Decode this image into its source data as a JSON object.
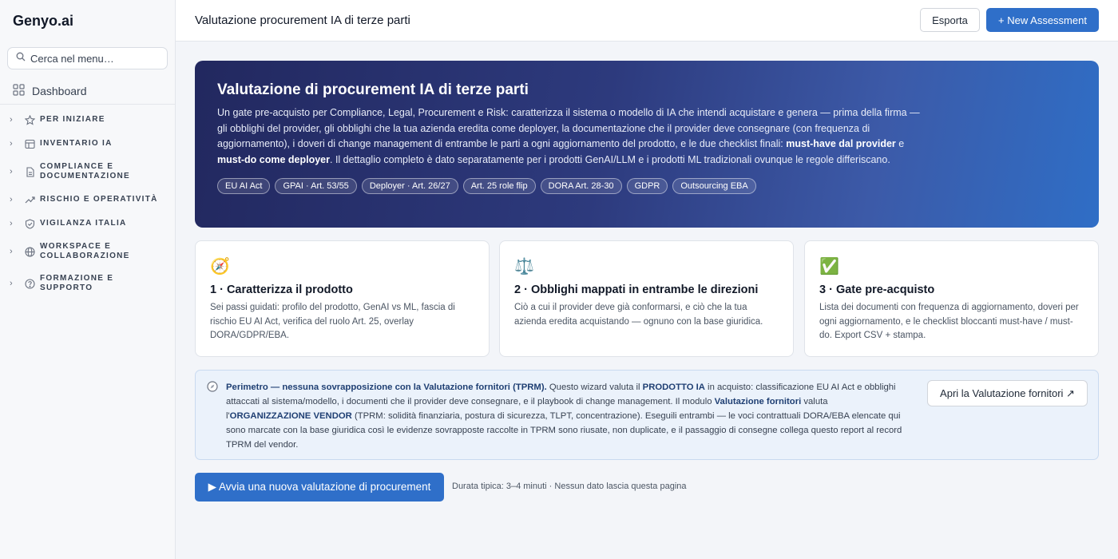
{
  "sidebar": {
    "brand": "Genyo.ai",
    "search_placeholder": "Cerca nel menu…",
    "dashboard_label": "Dashboard",
    "sections": [
      {
        "label": "PER INIZIARE",
        "icon": "star-icon"
      },
      {
        "label": "INVENTARIO IA",
        "icon": "table-icon"
      },
      {
        "label": "COMPLIANCE E DOCUMENTAZIONE",
        "icon": "document-icon"
      },
      {
        "label": "RISCHIO E OPERATIVITÀ",
        "icon": "trend-icon"
      },
      {
        "label": "VIGILANZA ITALIA",
        "icon": "shield-icon"
      },
      {
        "label": "WORKSPACE E COLLABORAZIONE",
        "icon": "globe-icon"
      },
      {
        "label": "FORMAZIONE E SUPPORTO",
        "icon": "help-icon"
      }
    ]
  },
  "header": {
    "title": "Valutazione procurement IA di terze parti",
    "export_label": "Esporta",
    "new_assessment_label": "+ New Assessment"
  },
  "hero": {
    "title": "Valutazione di procurement IA di terze parti",
    "desc_1": "Un gate pre-acquisto per Compliance, Legal, Procurement e Risk: caratterizza il sistema o modello di IA che intendi acquistare e genera — prima della firma — gli obblighi del provider, gli obblighi che la tua azienda eredita come deployer, la documentazione che il provider deve consegnare (con frequenza di aggiornamento), i doveri di change management di entrambe le parti a ogni aggiornamento del prodotto, e le due checklist finali: ",
    "desc_bold_1": "must-have dal provider",
    "desc_2": " e ",
    "desc_bold_2": "must-do come deployer",
    "desc_3": ". Il dettaglio completo è dato separatamente per i prodotti GenAI/LLM e i prodotti ML tradizionali ovunque le regole differiscano.",
    "tags": [
      "EU AI Act",
      "GPAI · Art. 53/55",
      "Deployer · Art. 26/27",
      "Art. 25 role flip",
      "DORA Art. 28-30",
      "GDPR",
      "Outsourcing EBA"
    ]
  },
  "cards": [
    {
      "icon": "compass-icon",
      "glyph": "🧭",
      "title": "1 · Caratterizza il prodotto",
      "desc": "Sei passi guidati: profilo del prodotto, GenAI vs ML, fascia di rischio EU AI Act, verifica del ruolo Art. 25, overlay DORA/GDPR/EBA."
    },
    {
      "icon": "scales-icon",
      "glyph": "⚖️",
      "title": "2 · Obblighi mappati in entrambe le direzioni",
      "desc": "Ciò a cui il provider deve già conformarsi, e ciò che la tua azienda eredita acquistando — ognuno con la base giuridica."
    },
    {
      "icon": "check-icon",
      "glyph": "✅",
      "title": "3 · Gate pre-acquisto",
      "desc": "Lista dei documenti con frequenza di aggiornamento, doveri per ogni aggiornamento, e le checklist bloccanti must-have / must-do. Export CSV + stampa."
    }
  ],
  "info": {
    "b1": "Perimetro — nessuna sovrapposizione con la Valutazione fornitori (TPRM).",
    "t1": " Questo wizard valuta il ",
    "b2": "PRODOTTO IA",
    "t2": " in acquisto: classificazione EU AI Act e obblighi attaccati al sistema/modello, i documenti che il provider deve consegnare, e il playbook di change management. Il modulo ",
    "b3": "Valutazione fornitori",
    "t3": " valuta l'",
    "b4": "ORGANIZZAZIONE VENDOR",
    "t4": " (TPRM: solidità finanziaria, postura di sicurezza, TLPT, concentrazione). Eseguili entrambi — le voci contrattuali DORA/EBA elencate qui sono marcate con la base giuridica così le evidenze sovrapposte raccolte in TPRM sono riusate, non duplicate, e il passaggio di consegne collega questo report al record TPRM del vendor.",
    "button_label": "Apri la Valutazione fornitori ↗"
  },
  "cta": {
    "label": "▶ Avvia una nuova valutazione di procurement",
    "note": "Durata tipica: 3–4 minuti · Nessun dato lascia questa pagina"
  }
}
